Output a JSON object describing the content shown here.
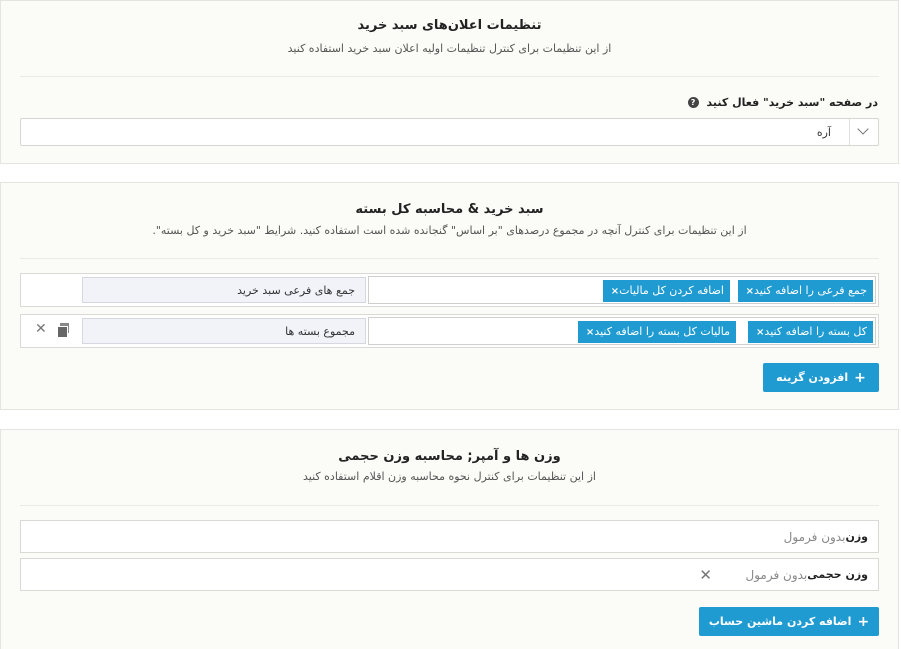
{
  "cart_notice": {
    "title": "تنظیمات اعلان‌های سبد خرید",
    "description": "از این تنظیمات برای کنترل تنظیمات اولیه اعلان سبد خرید استفاده کنید",
    "field_label": "در صفحه \"سبد خرید\" فعال کنید",
    "help_icon": "?",
    "select_value": "آره"
  },
  "totals": {
    "title": "سبد خرید & محاسبه کل بسته",
    "description": "از این تنظیمات برای کنترل آنچه در مجموع درصدهای \"بر اساس\" گنجانده شده است استفاده کنید. شرایط \"سبد خرید و کل بسته\".",
    "rows": [
      {
        "name": "جمع های فرعی سبد خرید",
        "tags": [
          "جمع فرعی را اضافه کنید",
          "اضافه کردن کل مالیات"
        ]
      },
      {
        "name": "مجموع بسته ها",
        "tags": [
          "کل بسته را اضافه کنید",
          "مالیات کل بسته را اضافه کنید"
        ]
      }
    ],
    "tag_remove": "×",
    "row_remove": "✕",
    "add_option_label": "افزودن گزینه",
    "plus": "+"
  },
  "weights": {
    "title": "وزن ها و آمپر; محاسبه وزن حجمی",
    "description": "از این تنظیمات برای کنترل نحوه محاسبه وزن اقلام استفاده کنید",
    "rows": [
      {
        "label": "وزن",
        "value": "بدون فرمول"
      },
      {
        "label": "وزن حجمی",
        "value": "بدون فرمول"
      }
    ],
    "row_remove": "✕",
    "add_calc_label": "اضافه کردن ماشین حساب",
    "plus": "+"
  }
}
